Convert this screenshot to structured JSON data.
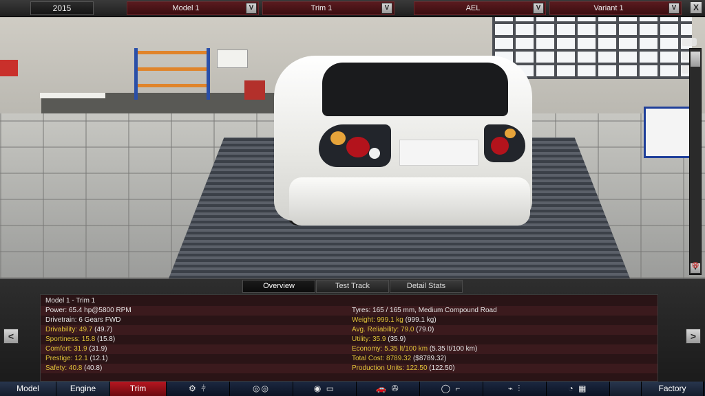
{
  "topbar": {
    "year": "2015",
    "model_label": "Model 1",
    "trim_label": "Trim 1",
    "engine_label": "AEL",
    "variant_label": "Variant 1",
    "dropdown_button": "V",
    "close_button": "X"
  },
  "viewport": {
    "scroll_down": "V",
    "target_icon": "⊗"
  },
  "tabs": [
    "Overview",
    "Test Track",
    "Detail Stats"
  ],
  "stats": {
    "header": "Model 1 - Trim 1",
    "left": [
      {
        "label": "Power: 65.4 hp@5800 RPM",
        "value": "",
        "highlight": false
      },
      {
        "label": "Drivetrain: 6 Gears FWD",
        "value": "",
        "highlight": false
      },
      {
        "label": "Drivability: 49.7",
        "value": "(49.7)",
        "highlight": true
      },
      {
        "label": "Sportiness: 15.8",
        "value": "(15.8)",
        "highlight": true
      },
      {
        "label": "Comfort: 31.9",
        "value": "(31.9)",
        "highlight": true
      },
      {
        "label": "Prestige: 12.1",
        "value": "(12.1)",
        "highlight": true
      },
      {
        "label": "Safety: 40.8",
        "value": "(40.8)",
        "highlight": true
      }
    ],
    "right": [
      {
        "label": "Tyres: 165 / 165 mm, Medium Compound Road",
        "value": "",
        "highlight": false
      },
      {
        "label": "Weight: 999.1 kg",
        "value": "(999.1 kg)",
        "highlight": true
      },
      {
        "label": "Avg. Reliability: 79.0",
        "value": "(79.0)",
        "highlight": true
      },
      {
        "label": "Utility: 35.9",
        "value": "(35.9)",
        "highlight": true
      },
      {
        "label": "Economy: 5.35 lt/100 km",
        "value": "(5.35 lt/100 km)",
        "highlight": true
      },
      {
        "label": "Total Cost: 8789.32",
        "value": "($8789.32)",
        "highlight": true
      },
      {
        "label": "Production Units: 122.50",
        "value": "(122.50)",
        "highlight": true
      }
    ]
  },
  "arrows": {
    "prev": "<",
    "next": ">"
  },
  "nav": {
    "model": "Model",
    "engine": "Engine",
    "trim": "Trim",
    "tools": [
      {
        "icon": "gearbox-icon",
        "glyph": "⚙ ⫩"
      },
      {
        "icon": "wheels-icon",
        "glyph": "◎◎"
      },
      {
        "icon": "suspension-icon",
        "glyph": "◉ ▭"
      },
      {
        "icon": "body-icon",
        "glyph": "🚗 ✇"
      },
      {
        "icon": "interior-icon",
        "glyph": "◯ ⌐"
      },
      {
        "icon": "fixtures-icon",
        "glyph": "⌁ ⫶"
      },
      {
        "icon": "testing-icon",
        "glyph": "◔ ▦"
      }
    ],
    "factory": "Factory"
  },
  "colors": {
    "accent_red": "#b81620",
    "highlight_text": "#e0c239",
    "nav_blue": "#1b2740"
  }
}
